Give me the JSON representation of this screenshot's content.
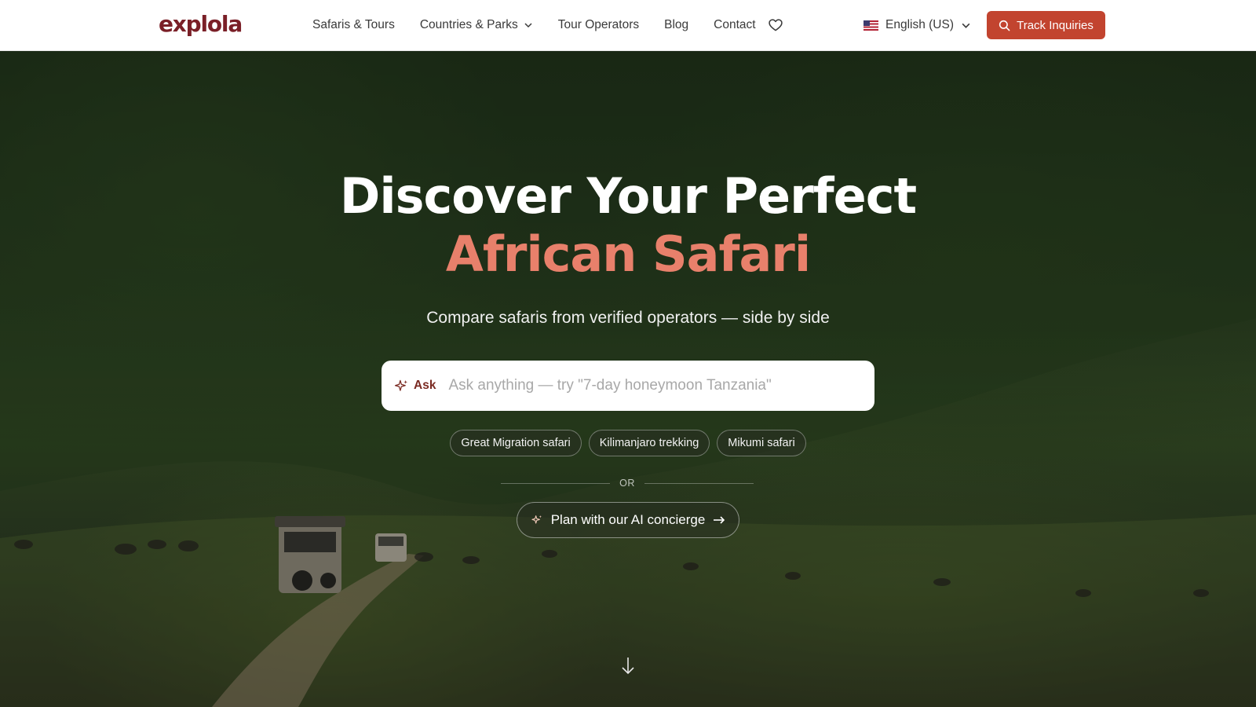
{
  "brand": {
    "name": "explola"
  },
  "nav": {
    "items": [
      {
        "label": "Safaris & Tours",
        "has_dropdown": false
      },
      {
        "label": "Countries & Parks",
        "has_dropdown": true
      },
      {
        "label": "Tour Operators",
        "has_dropdown": false
      },
      {
        "label": "Blog",
        "has_dropdown": false
      },
      {
        "label": "Contact",
        "has_dropdown": false
      }
    ],
    "wishlist_icon": "heart-icon",
    "language": {
      "label": "English (US)",
      "flag": "us-flag-icon"
    },
    "track_button": {
      "label": "Track Inquiries",
      "icon": "search-icon"
    }
  },
  "hero": {
    "title_line1": "Discover Your Perfect",
    "title_line2": "African Safari",
    "subtitle": "Compare safaris from verified operators — side by side",
    "ask": {
      "tag_label": "Ask",
      "tag_icon": "sparkles-icon",
      "placeholder": "Ask anything — try \"7-day honeymoon Tanzania\""
    },
    "chips": [
      "Great Migration safari",
      "Kilimanjaro trekking",
      "Mikumi safari"
    ],
    "or_label": "OR",
    "concierge_button": {
      "label": "Plan with our AI concierge",
      "icon": "sparkles-icon",
      "trailing_icon": "arrow-right-icon"
    },
    "scroll_icon": "arrow-down-icon"
  },
  "colors": {
    "brand": "#7a1f27",
    "accent": "#c2442f",
    "headline_highlight": "#e8806b",
    "header_bg": "#ffffff"
  }
}
